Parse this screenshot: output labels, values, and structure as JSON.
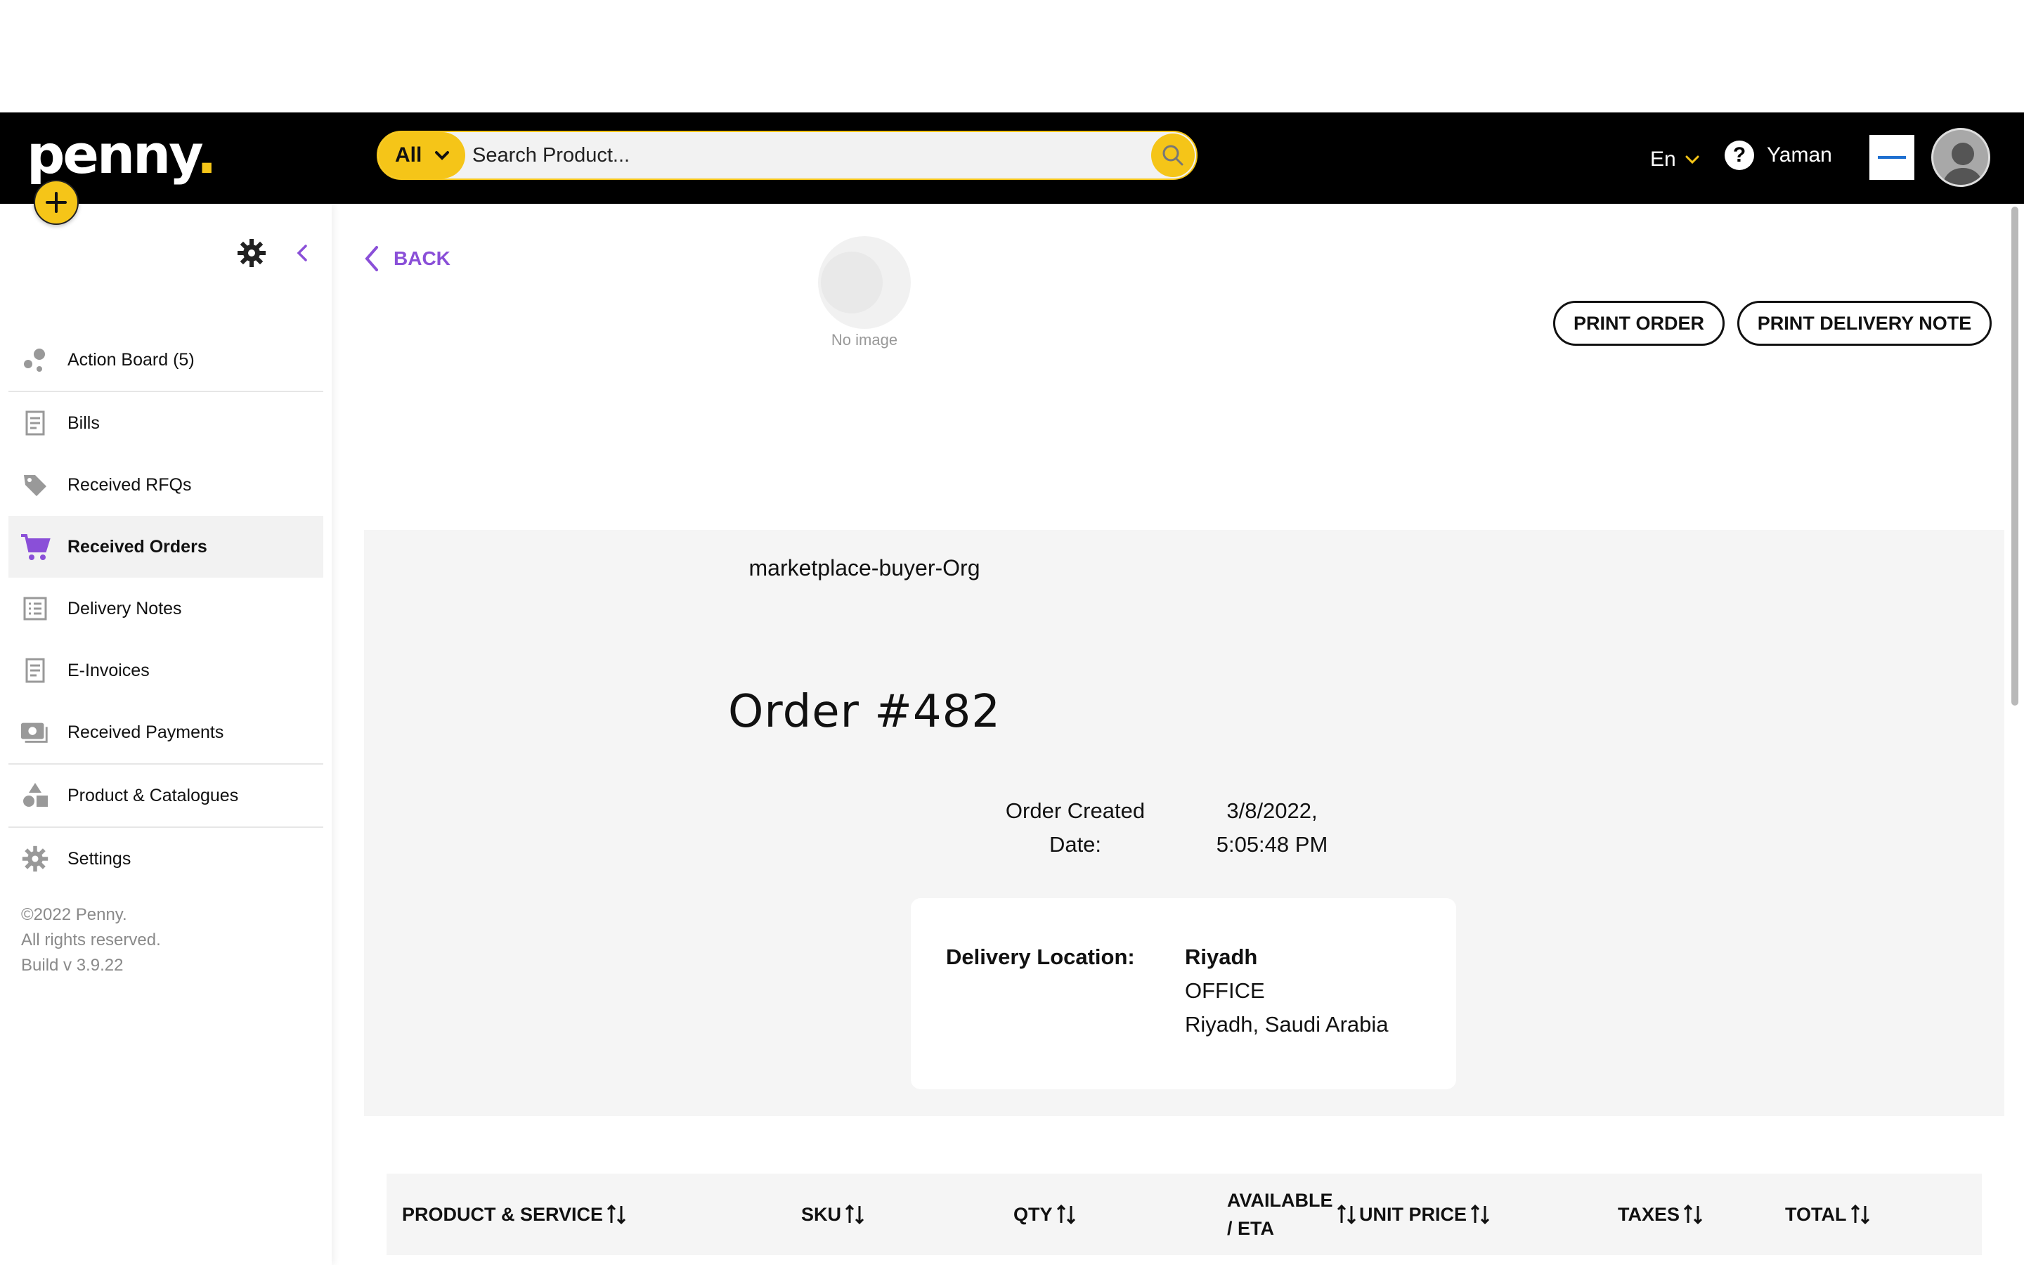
{
  "brand": {
    "logo_text": "penny",
    "logo_dot": ".",
    "accent": "#f5c518",
    "link_color": "#8a4fd8"
  },
  "search": {
    "category": "All",
    "placeholder": "Search Product..."
  },
  "header": {
    "language": "En",
    "user_name": "Yaman"
  },
  "sidebar": {
    "items": [
      {
        "label": "Action Board (5)",
        "icon": "action-board-icon"
      },
      {
        "label": "Bills",
        "icon": "bill-icon"
      },
      {
        "label": "Received RFQs",
        "icon": "tag-icon"
      },
      {
        "label": "Received Orders",
        "icon": "cart-icon",
        "active": true
      },
      {
        "label": "Delivery Notes",
        "icon": "list-icon"
      },
      {
        "label": "E-Invoices",
        "icon": "invoice-icon"
      },
      {
        "label": "Received Payments",
        "icon": "payment-icon"
      },
      {
        "label": "Product & Catalogues",
        "icon": "shapes-icon"
      },
      {
        "label": "Settings",
        "icon": "gear-icon"
      }
    ],
    "footer": {
      "copyright": "©2022 Penny.",
      "rights": "All rights reserved.",
      "build": "Build v 3.9.22"
    }
  },
  "main": {
    "back_label": "BACK",
    "print_order_label": "PRINT ORDER",
    "print_delivery_note_label": "PRINT DELIVERY NOTE",
    "no_image_text": "No image",
    "buyer_org": "marketplace-buyer-Org",
    "order_title": "Order #482",
    "created_label_1": "Order Created",
    "created_label_2": "Date:",
    "created_date": "3/8/2022,",
    "created_time": "5:05:48 PM",
    "delivery": {
      "label": "Delivery Location:",
      "city": "Riyadh",
      "type": "OFFICE",
      "address": "Riyadh, Saudi Arabia"
    },
    "table_headers": {
      "product": "PRODUCT & SERVICE",
      "sku": "SKU",
      "qty": "QTY",
      "available_1": "AVAILABLE",
      "available_2": "/ ETA",
      "unit_price": "UNIT PRICE",
      "taxes": "TAXES",
      "total": "TOTAL"
    }
  }
}
